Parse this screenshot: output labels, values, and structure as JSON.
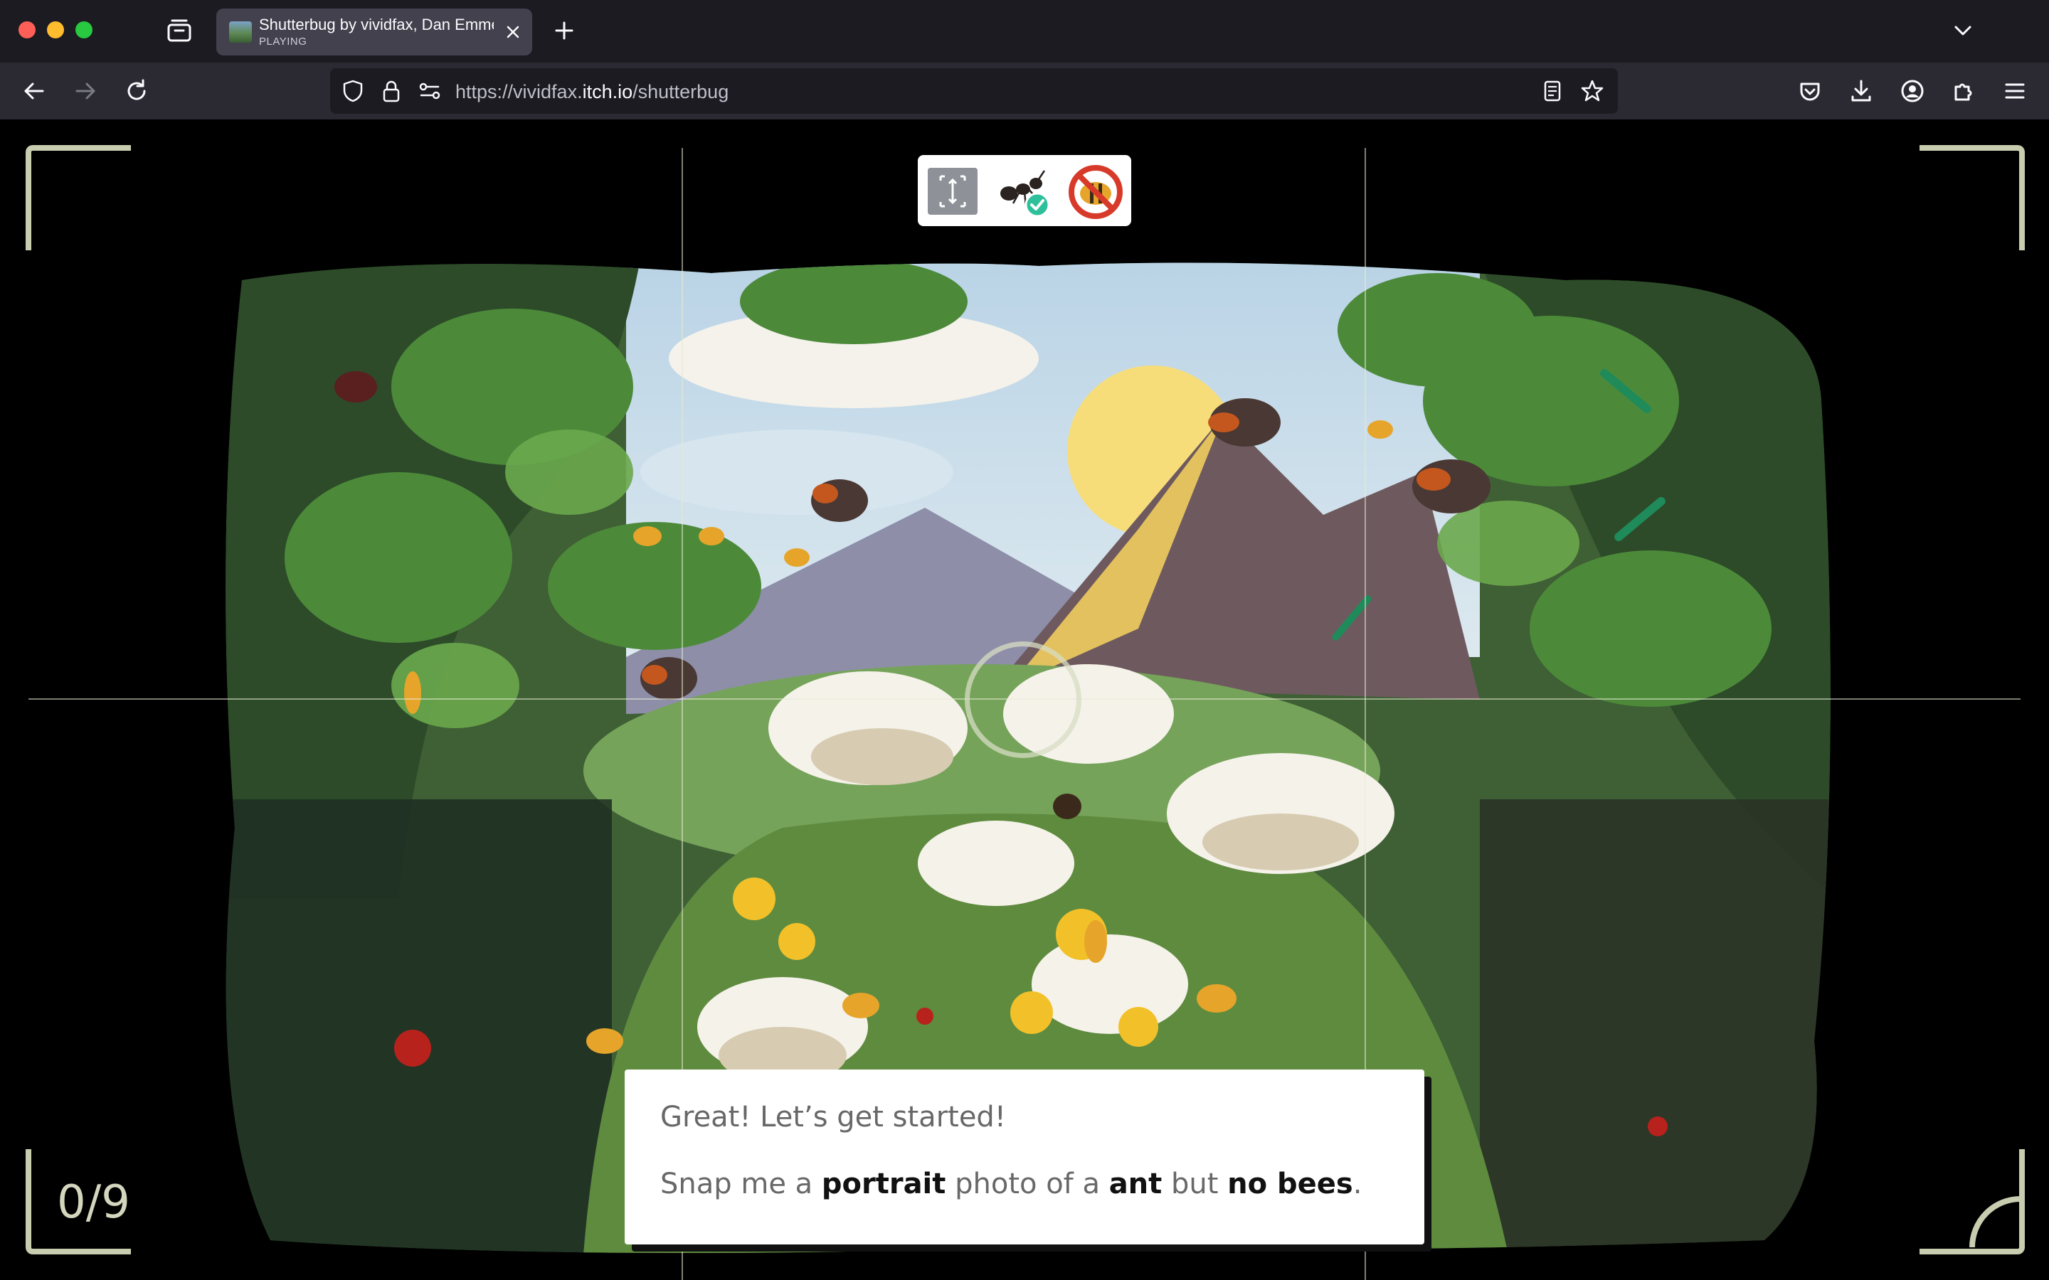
{
  "browser": {
    "tab": {
      "title": "Shutterbug by vividfax, Dan Emmerson",
      "subtitle": "PLAYING"
    },
    "url": {
      "prefix": "https://vividfax.",
      "domain": "itch.io",
      "path": "/shutterbug"
    }
  },
  "game": {
    "objectives": [
      {
        "icon": "portrait-frame-icon",
        "meaning": "portrait"
      },
      {
        "icon": "ant-required-icon",
        "meaning": "ant"
      },
      {
        "icon": "no-bees-icon",
        "meaning": "no bees"
      }
    ],
    "counter": "0/9",
    "dialog": {
      "line1": "Great! Let’s get started!",
      "line2_part1": "Snap me a ",
      "line2_bold1": "portrait",
      "line2_part2": " photo of a ",
      "line2_bold2": "ant",
      "line2_part3": " but ",
      "line2_bold3": "no bees",
      "line2_part4": "."
    }
  },
  "colors": {
    "titlebar": "#1c1b22",
    "navbar": "#2b2a33",
    "tab_active": "#42414d",
    "viewfinder": "#c9cdb0",
    "check_green": "#2ec09b",
    "forbid_red": "#d83a2a"
  }
}
